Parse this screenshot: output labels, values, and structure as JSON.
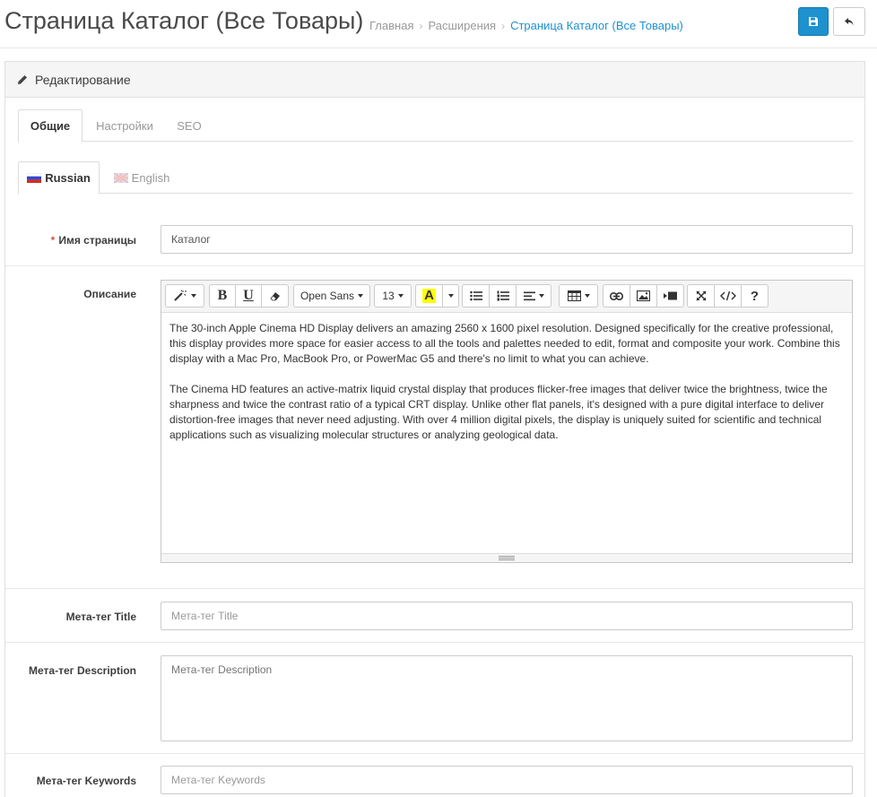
{
  "header": {
    "title": "Страница Каталог (Все Товары)",
    "breadcrumbs": [
      {
        "label": "Главная"
      },
      {
        "label": "Расширения"
      },
      {
        "label": "Страница Каталог (Все Товары)"
      }
    ],
    "separator": "›",
    "save_icon": "save-icon",
    "back_icon": "reply-icon",
    "accent_color": "#1e91cf"
  },
  "panel": {
    "heading": "Редактирование",
    "heading_icon": "pencil-icon"
  },
  "tabs": [
    {
      "label": "Общие",
      "active": true
    },
    {
      "label": "Настройки",
      "active": false
    },
    {
      "label": "SEO",
      "active": false
    }
  ],
  "language_tabs": [
    {
      "label": "Russian",
      "active": true,
      "flag": "ru-flag-icon"
    },
    {
      "label": "English",
      "active": false,
      "flag": "gb-flag-icon"
    }
  ],
  "form": {
    "page_name": {
      "label": "Имя страницы",
      "required": true,
      "value": "Каталог"
    },
    "description": {
      "label": "Описание",
      "paragraphs": [
        "The 30-inch Apple Cinema HD Display delivers an amazing 2560 x 1600 pixel resolution. Designed specifically for the creative professional, this display provides more space for easier access to all the tools and palettes needed to edit, format and composite your work. Combine this display with a Mac Pro, MacBook Pro, or PowerMac G5 and there's no limit to what you can achieve.",
        "The Cinema HD features an active-matrix liquid crystal display that produces flicker-free images that deliver twice the brightness, twice the sharpness and twice the contrast ratio of a typical CRT display. Unlike other flat panels, it's designed with a pure digital interface to deliver distortion-free images that never need adjusting. With over 4 million digital pixels, the display is uniquely suited for scientific and technical applications such as visualizing molecular structures or analyzing geological data."
      ]
    },
    "meta_title": {
      "label": "Мета-тег Title",
      "placeholder": "Мета-тег Title",
      "value": ""
    },
    "meta_description": {
      "label": "Мета-тег Description",
      "placeholder": "Мета-тег Description",
      "value": ""
    },
    "meta_keywords": {
      "label": "Мета-тег Keywords",
      "placeholder": "Мета-тег Keywords",
      "value": ""
    }
  },
  "editor_toolbar": {
    "font_family": "Open Sans",
    "font_size": "13",
    "buttons": [
      "magic-wand-icon",
      "bold-icon",
      "underline-icon",
      "eraser-icon",
      "font-color-icon",
      "unordered-list-icon",
      "ordered-list-icon",
      "paragraph-align-icon",
      "table-icon",
      "link-icon",
      "image-icon",
      "video-icon",
      "fullscreen-icon",
      "code-view-icon",
      "help-icon"
    ],
    "bold_glyph": "B",
    "underline_glyph": "U",
    "font_color_glyph": "A",
    "help_glyph": "?",
    "highlight_color": "#ffff00"
  }
}
